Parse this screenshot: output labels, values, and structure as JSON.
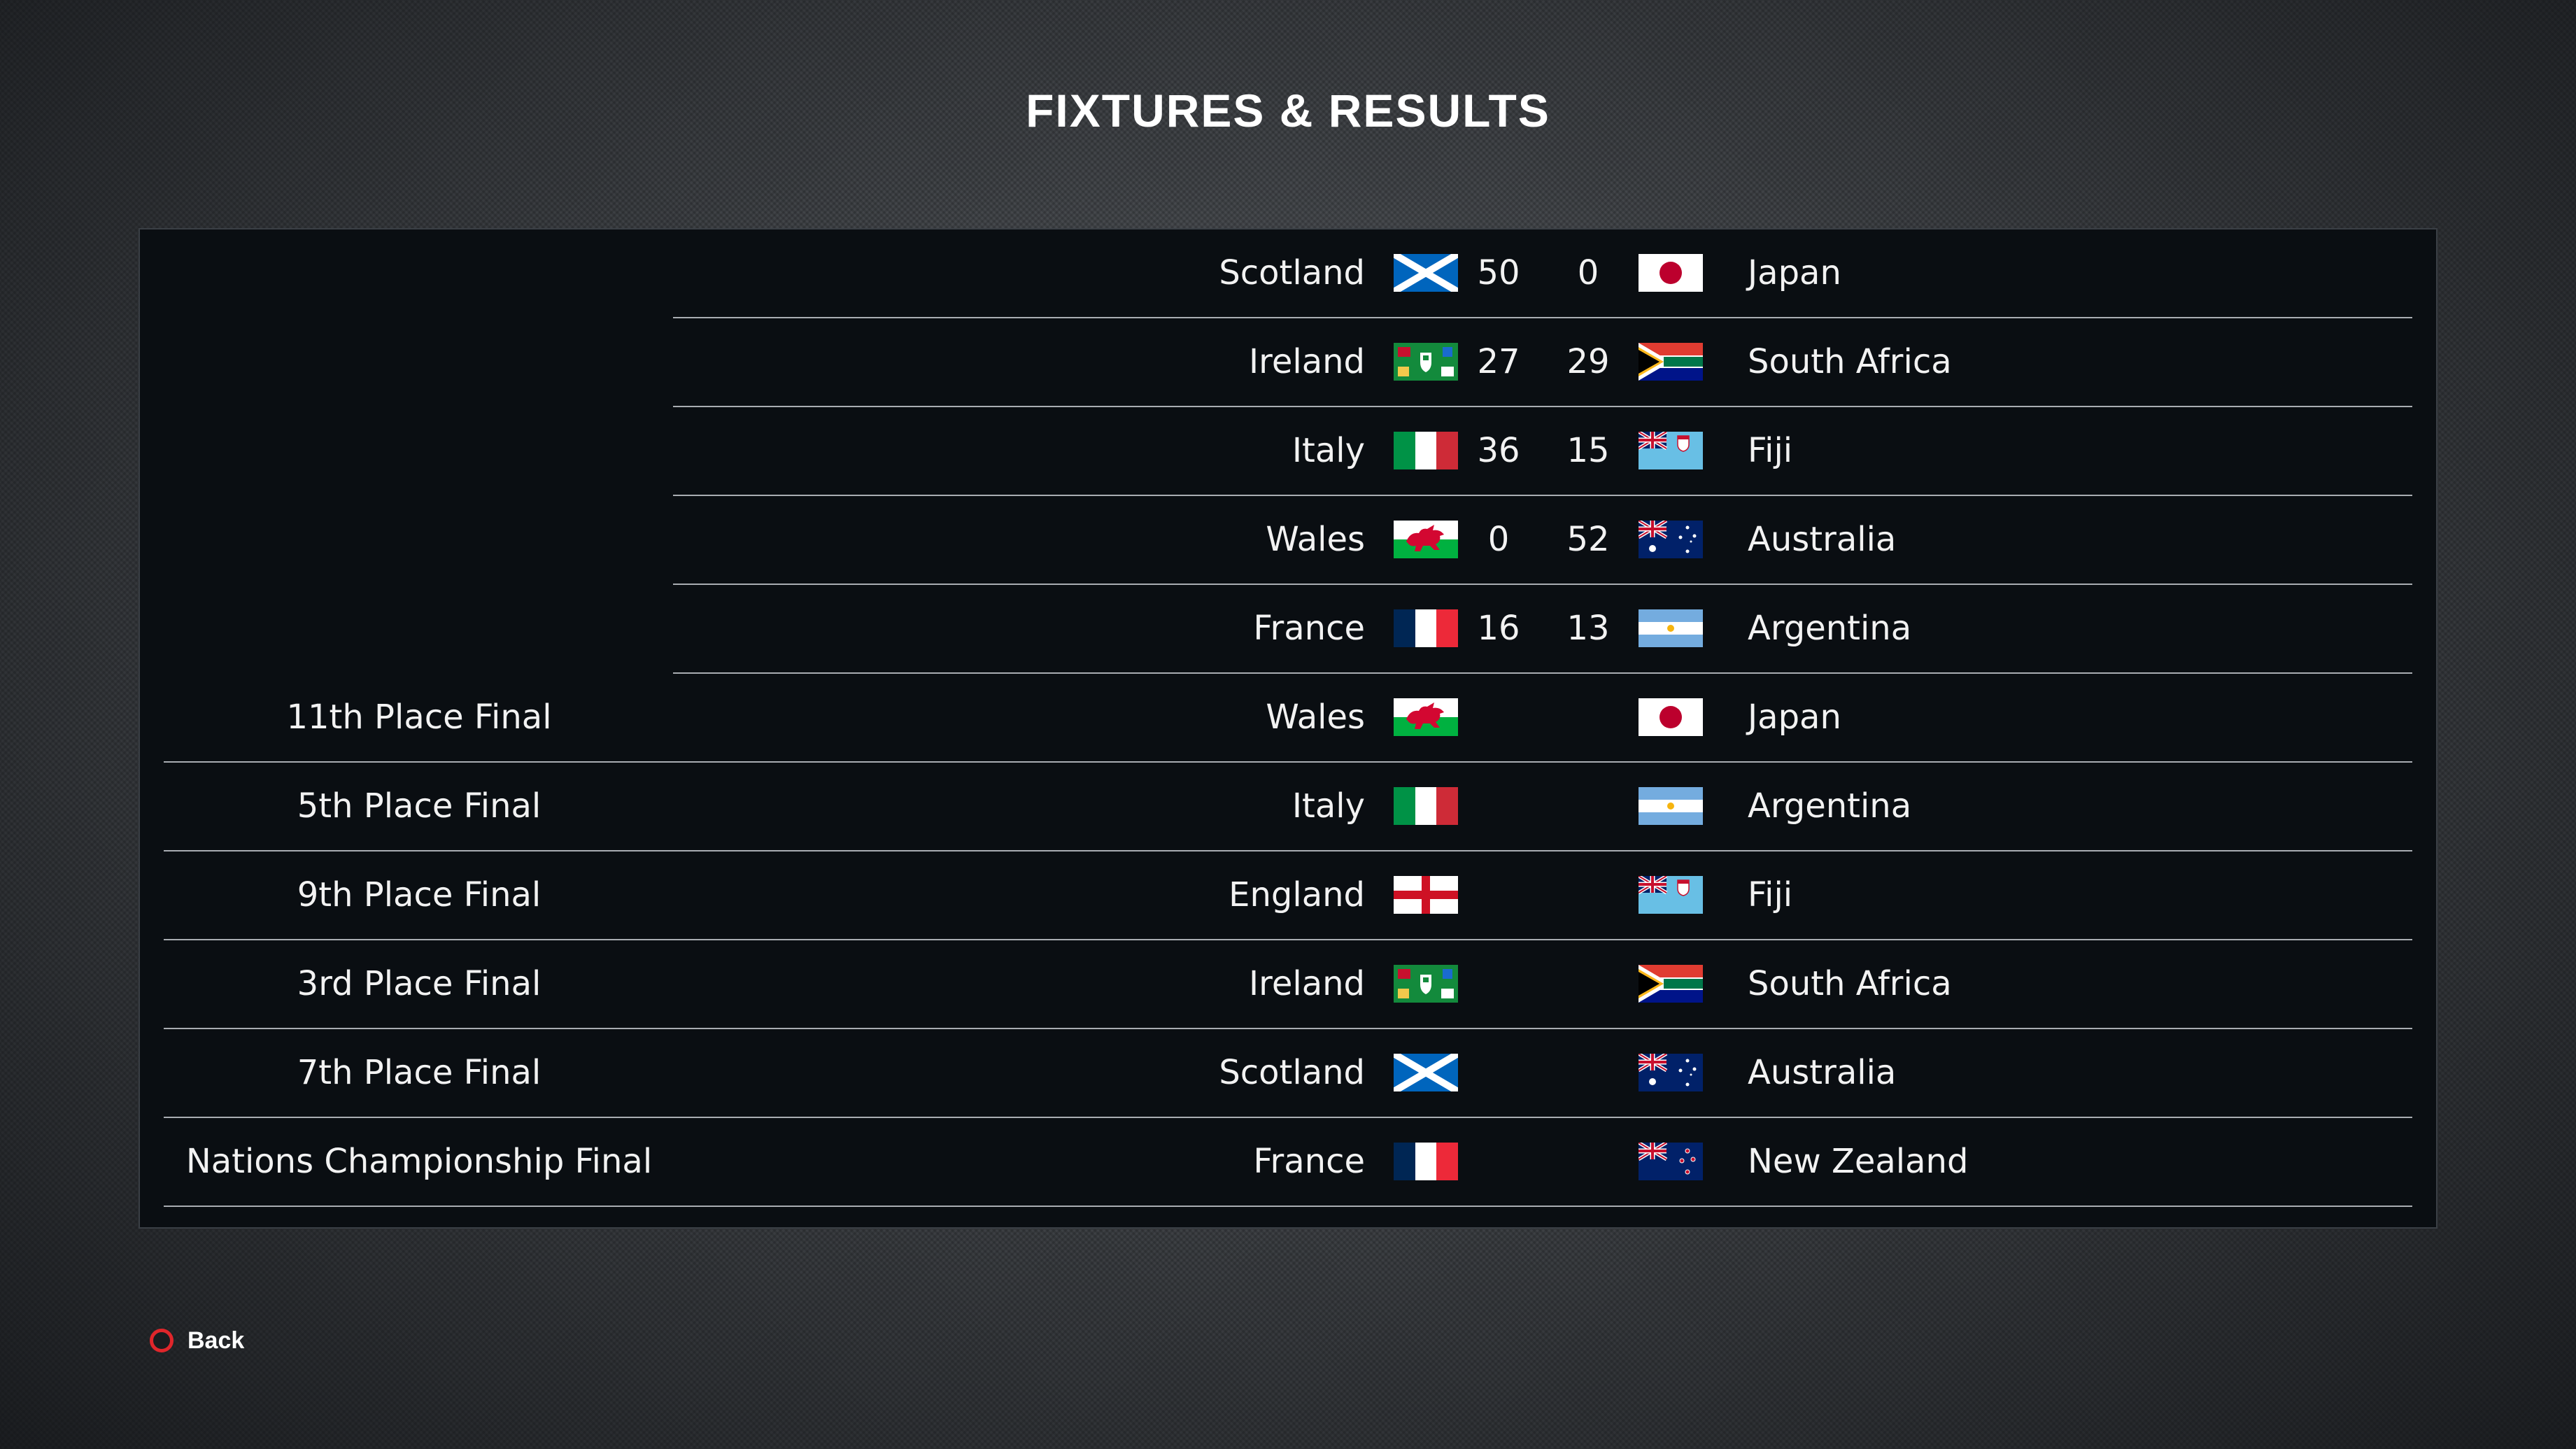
{
  "title": "FIXTURES & RESULTS",
  "back_label": "Back",
  "back_button_icon": "circle-icon",
  "results": [
    {
      "home": "Scotland",
      "home_flag": "scotland",
      "home_score": "50",
      "away_score": "0",
      "away": "Japan",
      "away_flag": "japan"
    },
    {
      "home": "Ireland",
      "home_flag": "ireland",
      "home_score": "27",
      "away_score": "29",
      "away": "South Africa",
      "away_flag": "south-africa"
    },
    {
      "home": "Italy",
      "home_flag": "italy",
      "home_score": "36",
      "away_score": "15",
      "away": "Fiji",
      "away_flag": "fiji"
    },
    {
      "home": "Wales",
      "home_flag": "wales",
      "home_score": "0",
      "away_score": "52",
      "away": "Australia",
      "away_flag": "australia"
    },
    {
      "home": "France",
      "home_flag": "france",
      "home_score": "16",
      "away_score": "13",
      "away": "Argentina",
      "away_flag": "argentina"
    }
  ],
  "fixtures": [
    {
      "round": "11th Place Final",
      "home": "Wales",
      "home_flag": "wales",
      "away": "Japan",
      "away_flag": "japan"
    },
    {
      "round": "5th Place Final",
      "home": "Italy",
      "home_flag": "italy",
      "away": "Argentina",
      "away_flag": "argentina"
    },
    {
      "round": "9th Place Final",
      "home": "England",
      "home_flag": "england",
      "away": "Fiji",
      "away_flag": "fiji"
    },
    {
      "round": "3rd Place Final",
      "home": "Ireland",
      "home_flag": "ireland",
      "away": "South Africa",
      "away_flag": "south-africa"
    },
    {
      "round": "7th Place Final",
      "home": "Scotland",
      "home_flag": "scotland",
      "away": "Australia",
      "away_flag": "australia"
    },
    {
      "round": "Nations Championship Final",
      "home": "France",
      "home_flag": "france",
      "away": "New Zealand",
      "away_flag": "new-zealand"
    }
  ],
  "colors": {
    "panel_bg": "#0a0e12",
    "divider": "#a9adb2",
    "back_button_ring": "#e0262b"
  }
}
